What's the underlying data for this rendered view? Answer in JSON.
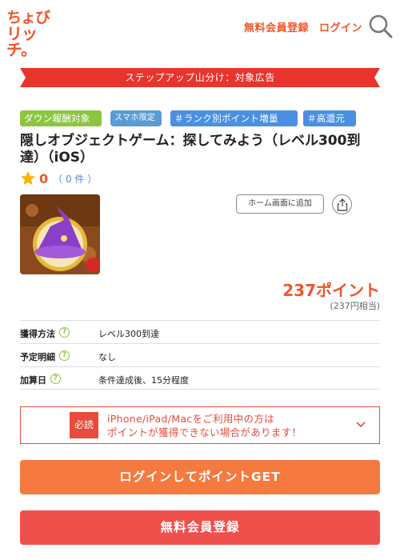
{
  "header": {
    "logo_line1": "ちょび",
    "logo_line2": "リッチ。",
    "register_link": "無料会員登録",
    "login_link": "ログイン",
    "search_icon": "search-icon"
  },
  "banner": {
    "text": "ステップアップ山分け：対象広告",
    "color": "#e8342c"
  },
  "tags": [
    {
      "label": "ダウン報酬対象",
      "color": "#8cc63f"
    },
    {
      "label": "スマホ限定",
      "color": "#5b9bd5"
    },
    {
      "label": "＃ランク別ポイント増量",
      "color": "#4a90e2"
    },
    {
      "label": "＃高還元",
      "color": "#4a90e2"
    }
  ],
  "title": "隠しオブジェクトゲーム：探してみよう（レベル300到達）（iOS）",
  "rating": {
    "value": "0",
    "count": "（ 0 件 ）"
  },
  "app_icon": "witch-hat-app-icon",
  "home_button": "ホーム画面に追加",
  "share_icon": "share-icon",
  "points": {
    "main": "237ポイント",
    "sub": "(237円相当)"
  },
  "info": [
    {
      "label": "獲得方法",
      "value": "レベル300到達"
    },
    {
      "label": "予定明細",
      "value": "なし"
    },
    {
      "label": "加算日",
      "value": "条件達成後、15分程度"
    }
  ],
  "notice": {
    "badge": "必読",
    "line1": "iPhone/iPad/Macをご利用中の方は",
    "line2": "ポイントが獲得できない場合があります！"
  },
  "buttons": {
    "login": "ログインしてポイントGET",
    "register": "無料会員登録"
  },
  "colors": {
    "brand": "#f0552b",
    "login_button": "#f6793f",
    "register_button": "#f0504b"
  }
}
